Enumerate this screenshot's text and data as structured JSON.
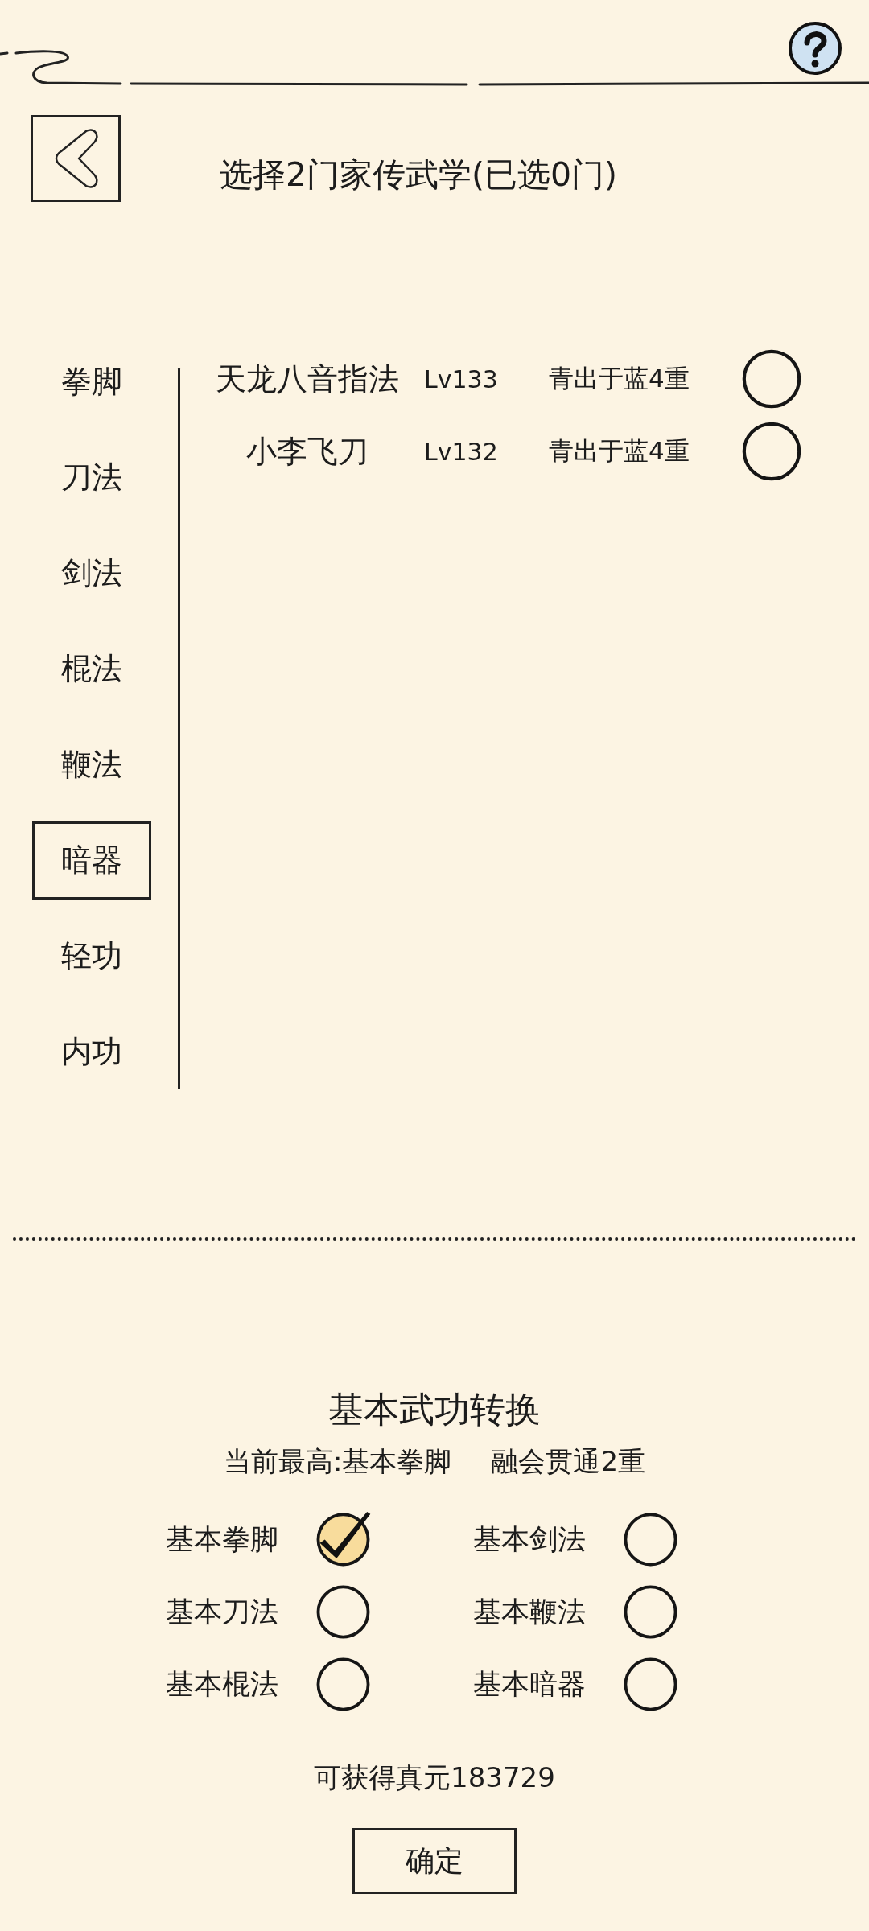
{
  "header": {
    "title": "选择2门家传武学(已选0门)"
  },
  "categories": [
    {
      "label": "拳脚",
      "selected": false
    },
    {
      "label": "刀法",
      "selected": false
    },
    {
      "label": "剑法",
      "selected": false
    },
    {
      "label": "棍法",
      "selected": false
    },
    {
      "label": "鞭法",
      "selected": false
    },
    {
      "label": "暗器",
      "selected": true
    },
    {
      "label": "轻功",
      "selected": false
    },
    {
      "label": "内功",
      "selected": false
    }
  ],
  "skills": [
    {
      "name": "天龙八音指法",
      "grade": "Lv133",
      "stage": "青出于蓝4重",
      "selected": false
    },
    {
      "name": "小李飞刀",
      "grade": "Lv132",
      "stage": "青出于蓝4重",
      "selected": false
    }
  ],
  "conversion": {
    "title": "基本武功转换",
    "current_best": "当前最高:基本拳脚",
    "mastery": "融会贯通2重",
    "options": [
      {
        "label": "基本拳脚",
        "checked": true
      },
      {
        "label": "基本剑法",
        "checked": false
      },
      {
        "label": "基本刀法",
        "checked": false
      },
      {
        "label": "基本鞭法",
        "checked": false
      },
      {
        "label": "基本棍法",
        "checked": false
      },
      {
        "label": "基本暗器",
        "checked": false
      }
    ],
    "reward": "可获得真元183729"
  },
  "confirm_button": "确定"
}
